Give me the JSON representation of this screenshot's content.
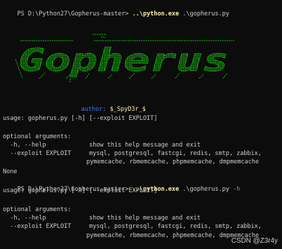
{
  "session1": {
    "prompt": "PS D:\\Python27\\Gopherus-master> ",
    "cmd_exe": "..\\python.exe",
    "cmd_args": " .\\gopherus.py"
  },
  "banner": {
    "logo_text": "Gopherus",
    "color": "#16c60c"
  },
  "author": {
    "label": "author:",
    "name": " $_SpyD3r_$"
  },
  "help1": {
    "usage": "usage: gopherus.py [-h] [--exploit EXPLOIT]",
    "optional_header": "optional arguments:",
    "opt_help_flags": "  -h, --help            ",
    "opt_help_desc": "show this help message and exit",
    "opt_exploit_flags": "  --exploit EXPLOIT     ",
    "opt_exploit_desc1": "mysql, postgresql, fastcgi, redis, smtp, zabbix,",
    "opt_exploit_desc2": "pymemcache, rbmemcache, phpmemcache, dmpmemcache",
    "none": "None"
  },
  "session2": {
    "prompt": "PS D:\\Python27\\Gopherus-master> ",
    "cmd_exe": "..\\python.exe",
    "cmd_args": " .\\gopherus.py ",
    "cmd_flag": "-h"
  },
  "help2": {
    "usage": "usage: gopherus.py [-h] [--exploit EXPLOIT]",
    "optional_header": "optional arguments:",
    "opt_help_flags": "  -h, --help            ",
    "opt_help_desc": "show this help message and exit",
    "opt_exploit_flags": "  --exploit EXPLOIT     ",
    "opt_exploit_desc1": "mysql, postgresql, fastcgi, redis, smtp, zabbix,",
    "opt_exploit_desc2": "pymemcache, rbmemcache, phpmemcache, dmpmemcache"
  },
  "watermark": "CSDN @Z3r4y"
}
